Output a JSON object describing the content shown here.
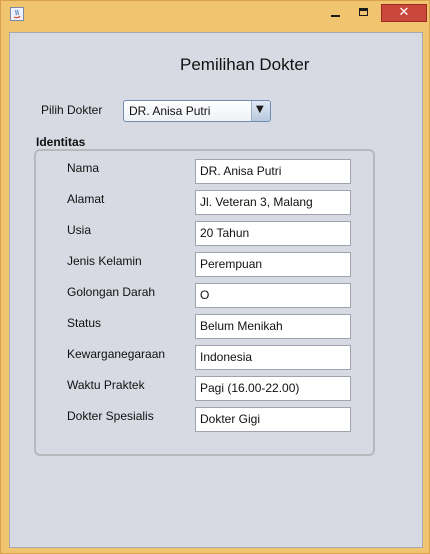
{
  "window": {
    "controls": {
      "minimize_icon": "minimize-icon",
      "maximize_icon": "maximize-icon",
      "close_icon": "close-icon",
      "close_glyph": "✕"
    },
    "app_icon": "java-app-icon"
  },
  "header": {
    "title": "Pemilihan Dokter"
  },
  "selector": {
    "label": "Pilih Dokter",
    "selected": "DR. Anisa Putri",
    "arrow_glyph": "▼"
  },
  "identity": {
    "group_label": "Identitas",
    "fields": [
      {
        "label": "Nama",
        "value": "DR. Anisa Putri"
      },
      {
        "label": "Alamat",
        "value": "Jl. Veteran 3, Malang"
      },
      {
        "label": "Usia",
        "value": "20 Tahun"
      },
      {
        "label": "Jenis Kelamin",
        "value": "Perempuan"
      },
      {
        "label": "Golongan Darah",
        "value": "O"
      },
      {
        "label": "Status",
        "value": "Belum Menikah"
      },
      {
        "label": "Kewarganegaraan",
        "value": "Indonesia"
      },
      {
        "label": "Waktu Praktek",
        "value": "Pagi (16.00-22.00)"
      },
      {
        "label": "Dokter Spesialis",
        "value": "Dokter Gigi"
      }
    ]
  }
}
